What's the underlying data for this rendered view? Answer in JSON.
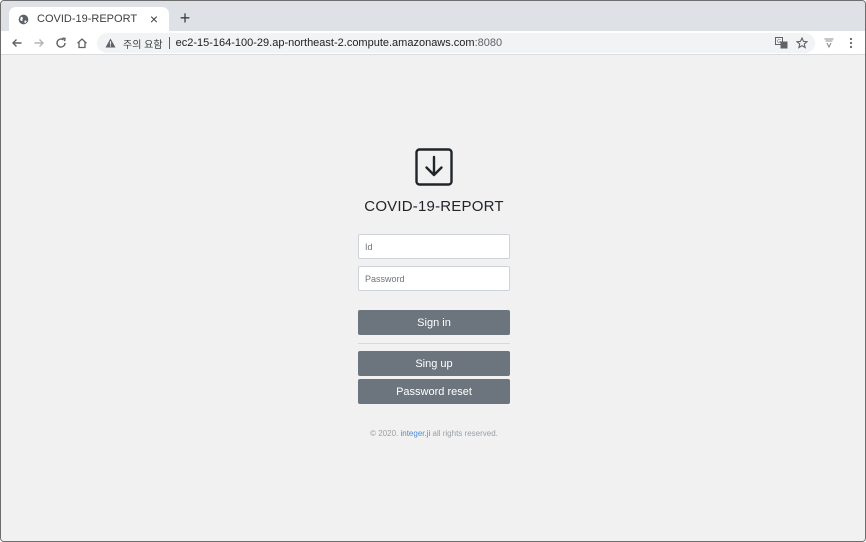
{
  "browser": {
    "tab_title": "COVID-19-REPORT",
    "tab_close": "×",
    "new_tab": "+",
    "security_label": "주의 요함",
    "url_host": "ec2-15-164-100-29.ap-northeast-2.compute.amazonaws.com",
    "url_port": ":8080"
  },
  "page": {
    "title": "COVID-19-REPORT",
    "id_placeholder": "Id",
    "password_placeholder": "Password",
    "signin_label": "Sign in",
    "signup_label": "Sing up",
    "reset_label": "Password reset",
    "footer_prefix": "© 2020.",
    "footer_link": "integer.ji",
    "footer_suffix": "all rights reserved."
  },
  "colors": {
    "button": "#6c757d",
    "link": "#4a90d9",
    "background": "#f1f1f1"
  }
}
